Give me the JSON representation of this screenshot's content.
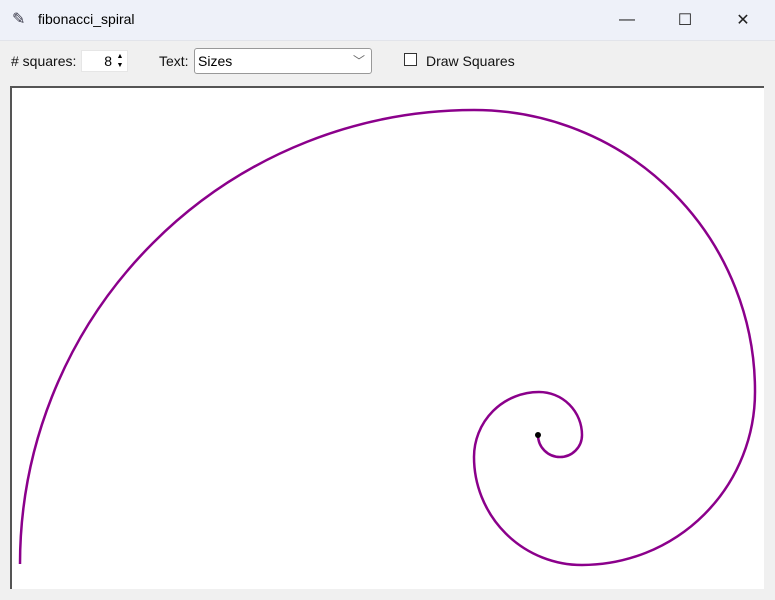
{
  "window": {
    "title": "fibonacci_spiral",
    "icon": "feather-icon"
  },
  "toolbar": {
    "squares_label": "# squares:",
    "squares_value": "8",
    "text_label": "Text:",
    "text_value": "Sizes",
    "draw_squares_label": "Draw Squares",
    "draw_squares_checked": false
  },
  "spiral": {
    "color": "#8b008b",
    "num_squares": 8
  }
}
